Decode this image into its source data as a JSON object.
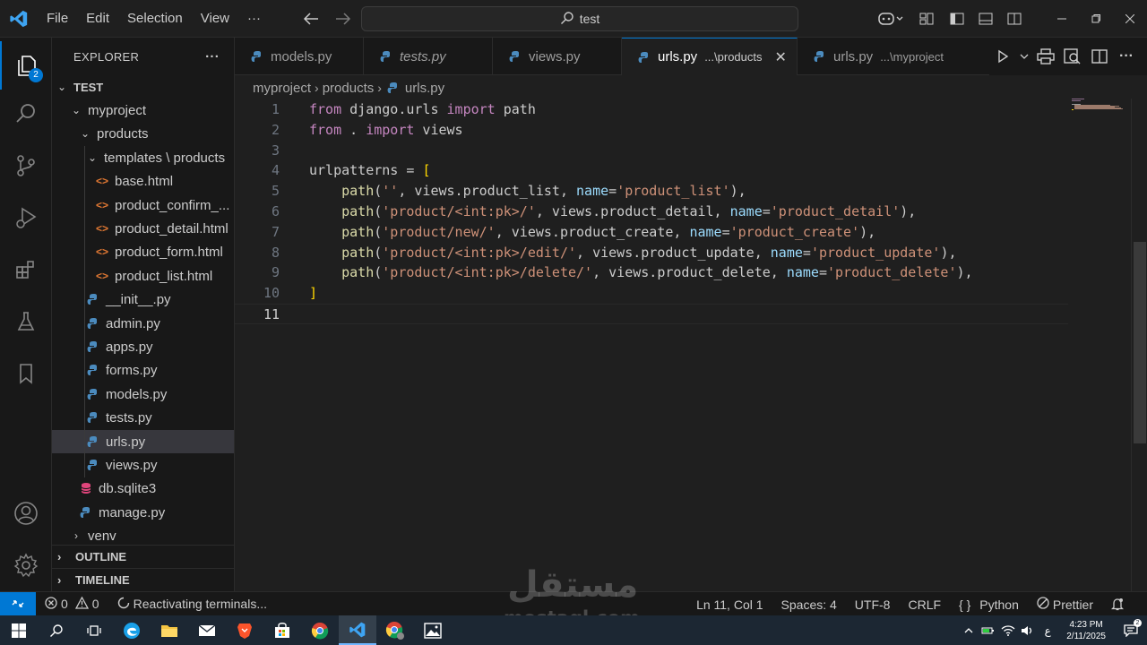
{
  "titlebar": {
    "menu": [
      "File",
      "Edit",
      "Selection",
      "View",
      "···"
    ],
    "search_text": "test"
  },
  "activity": {
    "explorer_badge": "2"
  },
  "explorer": {
    "title": "EXPLORER",
    "more": "···",
    "root": "TEST",
    "tree": [
      {
        "label": "myproject",
        "kind": "folder-open",
        "depth": 1
      },
      {
        "label": "products",
        "kind": "folder-open",
        "depth": 2
      },
      {
        "label": "templates \\ products",
        "kind": "folder-open",
        "depth": 3
      },
      {
        "label": "base.html",
        "kind": "html",
        "depth": 4
      },
      {
        "label": "product_confirm_...",
        "kind": "html",
        "depth": 4
      },
      {
        "label": "product_detail.html",
        "kind": "html",
        "depth": 4
      },
      {
        "label": "product_form.html",
        "kind": "html",
        "depth": 4
      },
      {
        "label": "product_list.html",
        "kind": "html",
        "depth": 4
      },
      {
        "label": "__init__.py",
        "kind": "py",
        "depth": 3
      },
      {
        "label": "admin.py",
        "kind": "py",
        "depth": 3
      },
      {
        "label": "apps.py",
        "kind": "py",
        "depth": 3
      },
      {
        "label": "forms.py",
        "kind": "py",
        "depth": 3
      },
      {
        "label": "models.py",
        "kind": "py",
        "depth": 3
      },
      {
        "label": "tests.py",
        "kind": "py",
        "depth": 3
      },
      {
        "label": "urls.py",
        "kind": "py",
        "depth": 3,
        "selected": true
      },
      {
        "label": "views.py",
        "kind": "py",
        "depth": 3
      },
      {
        "label": "db.sqlite3",
        "kind": "db",
        "depth": 2
      },
      {
        "label": "manage.py",
        "kind": "py",
        "depth": 2
      },
      {
        "label": "venv",
        "kind": "folder-closed",
        "depth": 1
      }
    ],
    "outline": "OUTLINE",
    "timeline": "TIMELINE"
  },
  "tabs": [
    {
      "label": "models.py",
      "italic": false
    },
    {
      "label": "tests.py",
      "italic": true
    },
    {
      "label": "views.py",
      "italic": false
    },
    {
      "label": "urls.py",
      "desc": "...\\products",
      "active": true
    },
    {
      "label": "urls.py",
      "desc": "...\\myproject"
    }
  ],
  "breadcrumb": [
    "myproject",
    "products",
    "urls.py"
  ],
  "code": {
    "current_line": 11,
    "lines": [
      [
        [
          "kw",
          "from"
        ],
        [
          "tx",
          " django.urls "
        ],
        [
          "kw",
          "import"
        ],
        [
          "tx",
          " path"
        ]
      ],
      [
        [
          "kw",
          "from"
        ],
        [
          "tx",
          " . "
        ],
        [
          "kw",
          "import"
        ],
        [
          "tx",
          " views"
        ]
      ],
      [],
      [
        [
          "tx",
          "urlpatterns = "
        ],
        [
          "br",
          "["
        ]
      ],
      [
        [
          "tx",
          "    "
        ],
        [
          "fn",
          "path"
        ],
        [
          "tx",
          "("
        ],
        [
          "st",
          "''"
        ],
        [
          "tx",
          ", views.product_list, "
        ],
        [
          "pm",
          "name"
        ],
        [
          "tx",
          "="
        ],
        [
          "st",
          "'product_list'"
        ],
        [
          "tx",
          "),"
        ]
      ],
      [
        [
          "tx",
          "    "
        ],
        [
          "fn",
          "path"
        ],
        [
          "tx",
          "("
        ],
        [
          "st",
          "'product/<int:pk>/'"
        ],
        [
          "tx",
          ", views.product_detail, "
        ],
        [
          "pm",
          "name"
        ],
        [
          "tx",
          "="
        ],
        [
          "st",
          "'product_detail'"
        ],
        [
          "tx",
          "),"
        ]
      ],
      [
        [
          "tx",
          "    "
        ],
        [
          "fn",
          "path"
        ],
        [
          "tx",
          "("
        ],
        [
          "st",
          "'product/new/'"
        ],
        [
          "tx",
          ", views.product_create, "
        ],
        [
          "pm",
          "name"
        ],
        [
          "tx",
          "="
        ],
        [
          "st",
          "'product_create'"
        ],
        [
          "tx",
          "),"
        ]
      ],
      [
        [
          "tx",
          "    "
        ],
        [
          "fn",
          "path"
        ],
        [
          "tx",
          "("
        ],
        [
          "st",
          "'product/<int:pk>/edit/'"
        ],
        [
          "tx",
          ", views.product_update, "
        ],
        [
          "pm",
          "name"
        ],
        [
          "tx",
          "="
        ],
        [
          "st",
          "'product_update'"
        ],
        [
          "tx",
          "),"
        ]
      ],
      [
        [
          "tx",
          "    "
        ],
        [
          "fn",
          "path"
        ],
        [
          "tx",
          "("
        ],
        [
          "st",
          "'product/<int:pk>/delete/'"
        ],
        [
          "tx",
          ", views.product_delete, "
        ],
        [
          "pm",
          "name"
        ],
        [
          "tx",
          "="
        ],
        [
          "st",
          "'product_delete'"
        ],
        [
          "tx",
          "),"
        ]
      ],
      [
        [
          "br",
          "]"
        ]
      ],
      []
    ]
  },
  "status": {
    "errors": "0",
    "warnings": "0",
    "task": "Reactivating terminals...",
    "position": "Ln 11, Col 1",
    "spaces": "Spaces: 4",
    "encoding": "UTF-8",
    "eol": "CRLF",
    "language": "Python",
    "formatter": "Prettier"
  },
  "watermark": {
    "arabic": "مستقل",
    "latin": "mostaql.com"
  },
  "taskbar": {
    "apps": [
      "start",
      "search",
      "task-view",
      "edge",
      "file-explorer",
      "mail",
      "brave",
      "store",
      "chrome",
      "vscode",
      "chrome-profile",
      "photos"
    ],
    "lang": "ع",
    "time": "4:23 PM",
    "date": "2/11/2025"
  },
  "colors": {
    "accent": "#0078d4",
    "editor_bg": "#1f1f1f",
    "sidebar_bg": "#181818",
    "taskbar_bg": "#1c2733"
  }
}
